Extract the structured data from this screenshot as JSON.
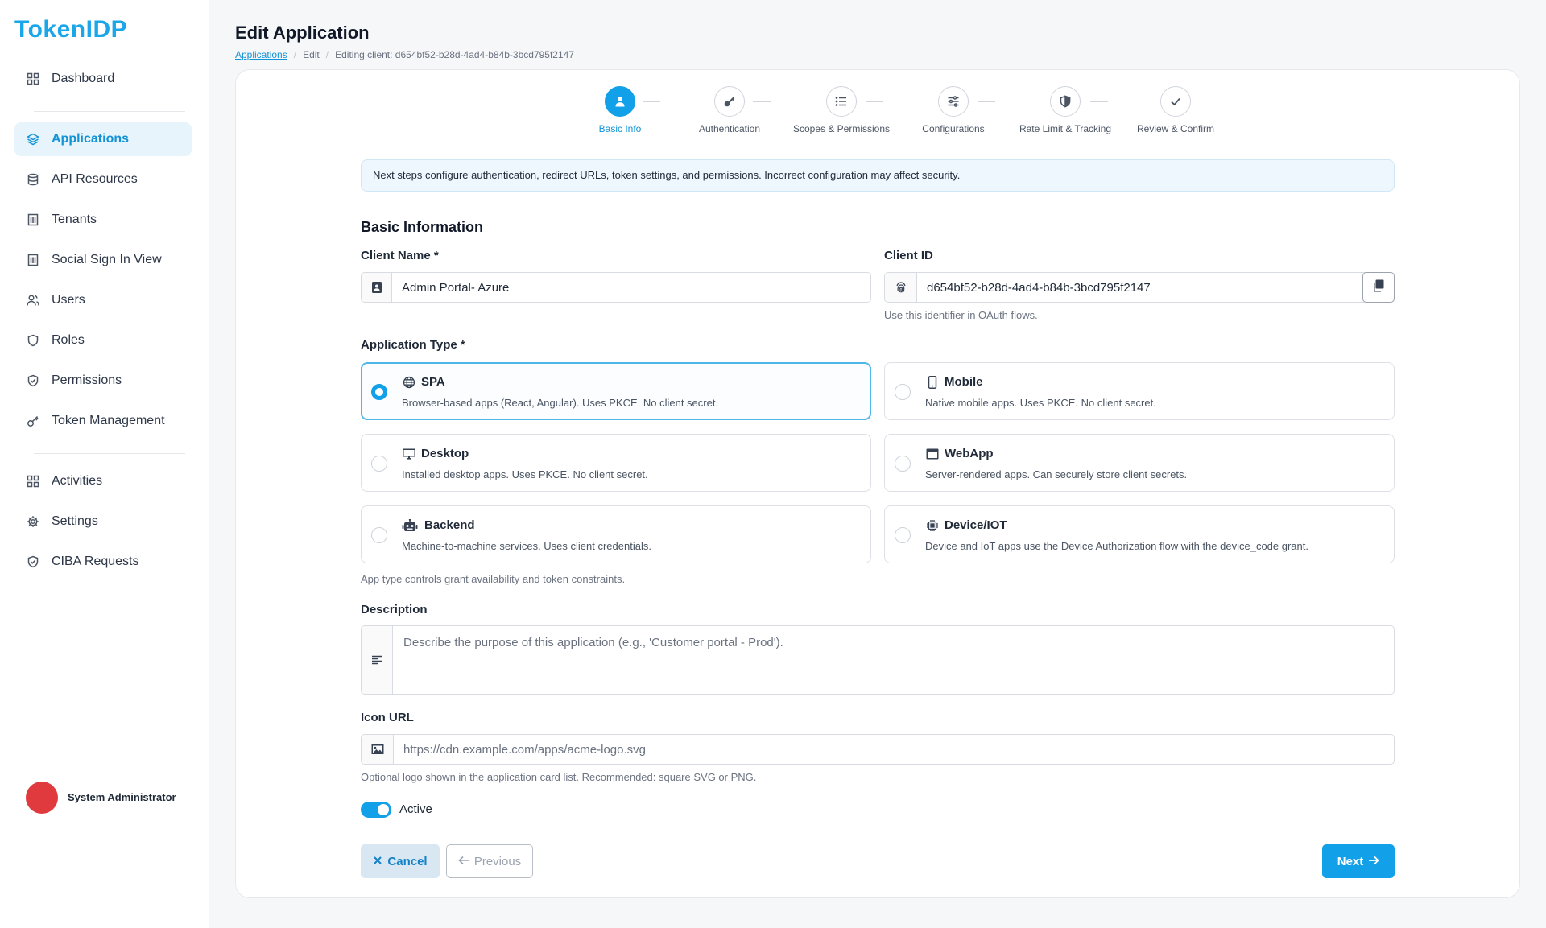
{
  "brand": {
    "logo_text": "TokenIDP"
  },
  "sidebar": {
    "items": [
      {
        "label": "Dashboard",
        "icon": "grid-icon"
      },
      {
        "label": "Applications",
        "icon": "layers-icon",
        "active": true
      },
      {
        "label": "API Resources",
        "icon": "database-icon"
      },
      {
        "label": "Tenants",
        "icon": "building-icon"
      },
      {
        "label": "Social Sign In View",
        "icon": "building-icon"
      },
      {
        "label": "Users",
        "icon": "users-icon"
      },
      {
        "label": "Roles",
        "icon": "shield-icon"
      },
      {
        "label": "Permissions",
        "icon": "shield-check-icon"
      },
      {
        "label": "Token Management",
        "icon": "key-icon"
      },
      {
        "label": "Activities",
        "icon": "grid-icon"
      },
      {
        "label": "Settings",
        "icon": "gear-icon"
      },
      {
        "label": "CIBA Requests",
        "icon": "shield-check-icon"
      }
    ],
    "user": {
      "name": "System Administrator"
    }
  },
  "header": {
    "title": "Edit Application",
    "breadcrumb": {
      "link": "Applications",
      "middle": "Edit",
      "current": "Editing client: d654bf52-b28d-4ad4-b84b-3bcd795f2147"
    }
  },
  "stepper": {
    "steps": [
      {
        "label": "Basic Info",
        "icon": "user-icon",
        "active": true
      },
      {
        "label": "Authentication",
        "icon": "key-icon"
      },
      {
        "label": "Scopes & Permissions",
        "icon": "list-icon"
      },
      {
        "label": "Configurations",
        "icon": "sliders-icon"
      },
      {
        "label": "Rate Limit & Tracking",
        "icon": "shield-icon"
      },
      {
        "label": "Review & Confirm",
        "icon": "check-icon"
      }
    ]
  },
  "info_banner": "Next steps configure authentication, redirect URLs, token settings, and permissions. Incorrect configuration may affect security.",
  "form": {
    "section_title": "Basic Information",
    "client_name": {
      "label": "Client Name *",
      "value": "Admin Portal- Azure"
    },
    "client_id": {
      "label": "Client ID",
      "value": "d654bf52-b28d-4ad4-b84b-3bcd795f2147",
      "hint": "Use this identifier in OAuth flows."
    },
    "app_type": {
      "label": "Application Type *",
      "hint": "App type controls grant availability and token constraints.",
      "options": [
        {
          "title": "SPA",
          "desc": "Browser-based apps (React, Angular). Uses PKCE. No client secret.",
          "icon": "globe-icon",
          "selected": true
        },
        {
          "title": "Mobile",
          "desc": "Native mobile apps. Uses PKCE. No client secret.",
          "icon": "phone-icon"
        },
        {
          "title": "Desktop",
          "desc": "Installed desktop apps. Uses PKCE. No client secret.",
          "icon": "monitor-icon"
        },
        {
          "title": "WebApp",
          "desc": "Server-rendered apps. Can securely store client secrets.",
          "icon": "browser-icon"
        },
        {
          "title": "Backend",
          "desc": "Machine-to-machine services. Uses client credentials.",
          "icon": "robot-icon"
        },
        {
          "title": "Device/IOT",
          "desc": "Device and IoT apps use the Device Authorization flow with the device_code grant.",
          "icon": "chip-icon"
        }
      ]
    },
    "description": {
      "label": "Description",
      "placeholder": "Describe the purpose of this application (e.g., 'Customer portal - Prod')."
    },
    "icon_url": {
      "label": "Icon URL",
      "placeholder": "https://cdn.example.com/apps/acme-logo.svg",
      "hint": "Optional logo shown in the application card list. Recommended: square SVG or PNG."
    },
    "active": {
      "label": "Active",
      "on": true
    }
  },
  "buttons": {
    "cancel": "Cancel",
    "previous": "Previous",
    "next": "Next"
  },
  "colors": {
    "accent": "#12a1e8",
    "avatar": "#e0393e"
  }
}
